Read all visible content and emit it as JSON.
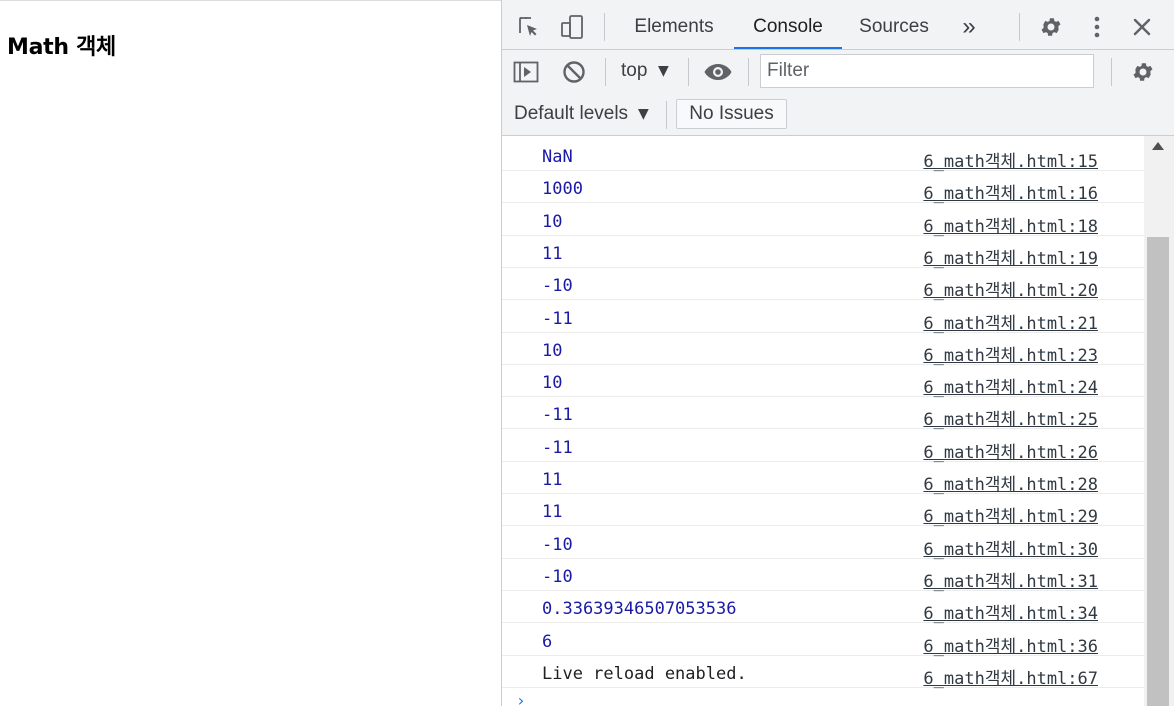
{
  "page": {
    "title": "Math 객체"
  },
  "devtools": {
    "tabs": [
      {
        "label": "Elements",
        "active": false
      },
      {
        "label": "Console",
        "active": true
      },
      {
        "label": "Sources",
        "active": false
      }
    ],
    "more_tabs_label": "»",
    "toolbar": {
      "context": "top",
      "filter_placeholder": "Filter",
      "levels": "Default levels",
      "issues": "No Issues"
    },
    "console_rows": [
      {
        "message": "NaN",
        "source": "6_math객체.html:15"
      },
      {
        "message": "1000",
        "source": "6_math객체.html:16"
      },
      {
        "message": "10",
        "source": "6_math객체.html:18"
      },
      {
        "message": "11",
        "source": "6_math객체.html:19"
      },
      {
        "message": "-10",
        "source": "6_math객체.html:20"
      },
      {
        "message": "-11",
        "source": "6_math객체.html:21"
      },
      {
        "message": "10",
        "source": "6_math객체.html:23"
      },
      {
        "message": "10",
        "source": "6_math객체.html:24"
      },
      {
        "message": "-11",
        "source": "6_math객체.html:25"
      },
      {
        "message": "-11",
        "source": "6_math객체.html:26"
      },
      {
        "message": "11",
        "source": "6_math객체.html:28"
      },
      {
        "message": "11",
        "source": "6_math객체.html:29"
      },
      {
        "message": "-10",
        "source": "6_math객체.html:30"
      },
      {
        "message": "-10",
        "source": "6_math객체.html:31"
      },
      {
        "message": "0.33639346507053536",
        "source": "6_math객체.html:34"
      },
      {
        "message": "6",
        "source": "6_math객체.html:36"
      },
      {
        "message": "Live reload enabled.",
        "source": "6_math객체.html:67"
      }
    ],
    "prompt_symbol": "›",
    "colors": {
      "accent": "#1a73e8",
      "number_value": "#1a1aa6",
      "toolbar_bg": "#f1f3f4"
    }
  }
}
